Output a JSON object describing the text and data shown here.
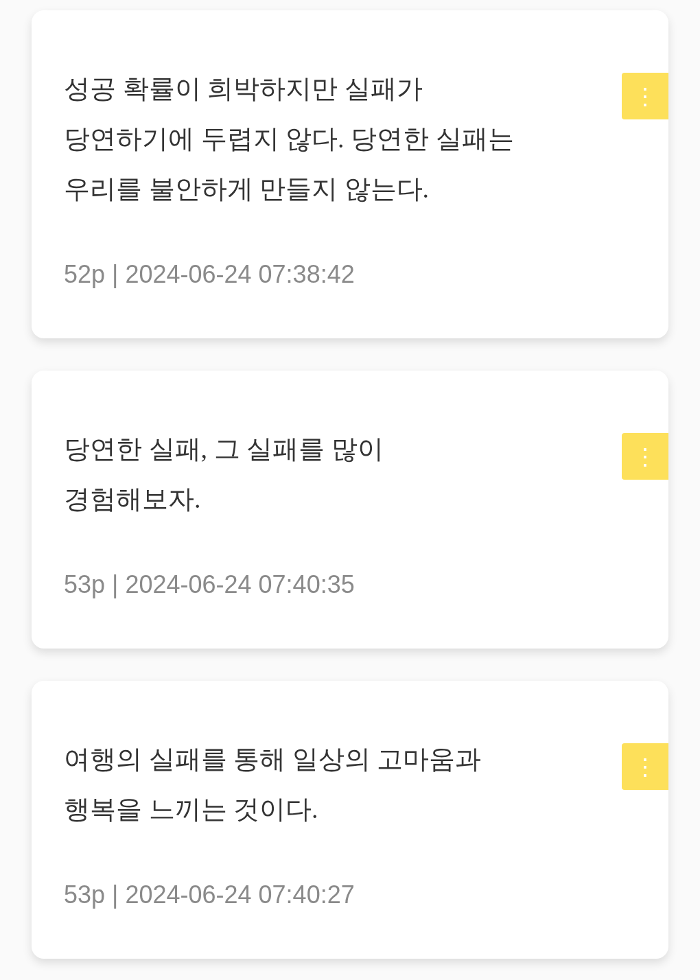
{
  "notes": [
    {
      "quote": "성공 확률이 희박하지만 실패가\n당연하기에 두렵지 않다. 당연한 실패는\n우리를 불안하게 만들지 않는다.",
      "meta": "52p | 2024-06-24 07:38:42",
      "menu": "⋮"
    },
    {
      "quote": "당연한 실패, 그 실패를 많이\n경험해보자.",
      "meta": "53p | 2024-06-24 07:40:35",
      "menu": "⋮"
    },
    {
      "quote": "여행의 실패를 통해 일상의 고마움과\n행복을 느끼는 것이다.",
      "meta": "53p | 2024-06-24 07:40:27",
      "menu": "⋮"
    }
  ]
}
